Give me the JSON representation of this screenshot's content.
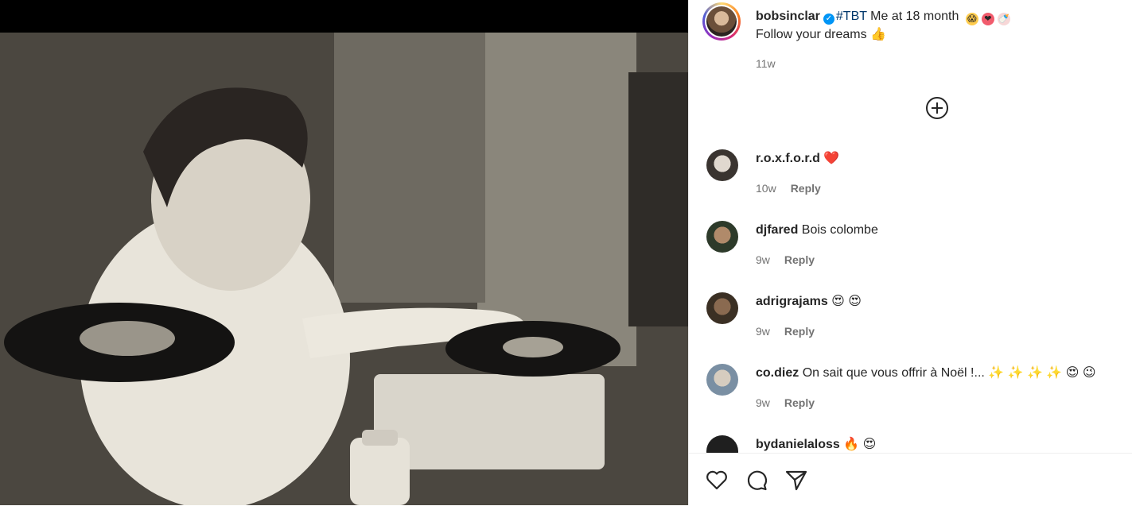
{
  "post": {
    "author": "bobsinclar",
    "hashtag": "#TBT",
    "caption_text": " Me at 18 month",
    "caption_line2": "Follow your dreams",
    "time": "11w",
    "emoji_line2": "👍"
  },
  "comments": [
    {
      "user": "r.o.x.f.o.r.d",
      "text": "",
      "emoji": "❤️",
      "time": "10w",
      "reply": "Reply"
    },
    {
      "user": "djfared",
      "text": "Bois colombe",
      "emoji": "",
      "time": "9w",
      "reply": "Reply"
    },
    {
      "user": "adrigrajams",
      "text": "",
      "emoji": "😍 😍",
      "time": "9w",
      "reply": "Reply"
    },
    {
      "user": "co.diez",
      "text": "On sait que vous offrir à Noël !...",
      "emoji": "✨ ✨ ✨ ✨ 😍 😉",
      "time": "9w",
      "reply": "Reply"
    },
    {
      "user": "bydanielaloss",
      "text": "",
      "emoji": "🔥 😍",
      "time": "",
      "reply": ""
    }
  ],
  "icons": {
    "verified": "verified-badge-icon",
    "more": "plus-circle-icon",
    "like": "heart-icon",
    "comment": "speech-bubble-icon",
    "share": "paper-plane-icon"
  },
  "colors": {
    "accent_blue": "#0095f6",
    "hashtag": "#00376b",
    "secondary_text": "#737373"
  }
}
